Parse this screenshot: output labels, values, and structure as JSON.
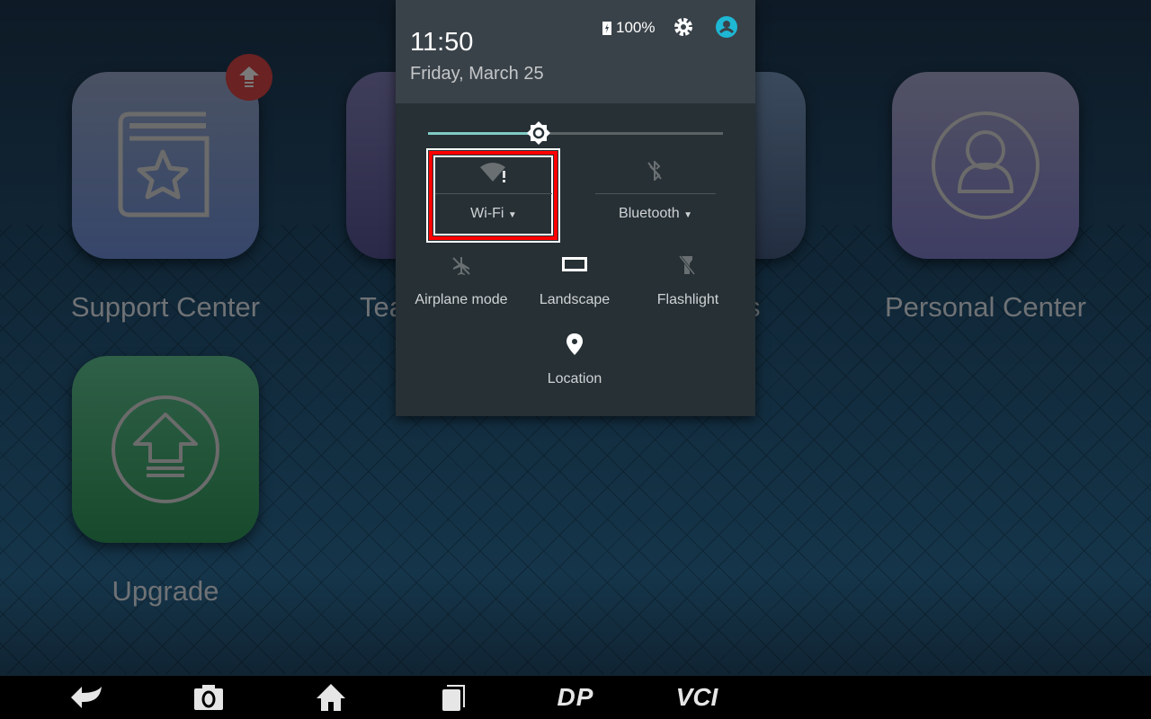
{
  "home": {
    "apps": [
      {
        "label": "Support Center",
        "icon": "book-star-icon"
      },
      {
        "label": "Tea",
        "icon": "tablet-icon"
      },
      {
        "label": "s",
        "icon": "dots-icon"
      },
      {
        "label": "Personal Center",
        "icon": "person-circle-icon"
      },
      {
        "label": "Upgrade",
        "icon": "upgrade-arrow-icon"
      }
    ],
    "badge_icon": "update-arrow-icon"
  },
  "panel": {
    "time": "11:50",
    "date": "Friday, March 25",
    "battery": "100%",
    "brightness_percent": 37,
    "tiles": {
      "wifi": "Wi-Fi",
      "bluetooth": "Bluetooth",
      "airplane": "Airplane mode",
      "landscape": "Landscape",
      "flashlight": "Flashlight",
      "location": "Location"
    },
    "colors": {
      "accent": "#80cbc4",
      "highlight": "#ff0000",
      "avatar": "#1eb7d4"
    }
  },
  "navbar": {
    "items": [
      "back",
      "screenshot",
      "home",
      "recents",
      "DP",
      "VCI"
    ],
    "dp": "DP",
    "vci": "VCI"
  }
}
